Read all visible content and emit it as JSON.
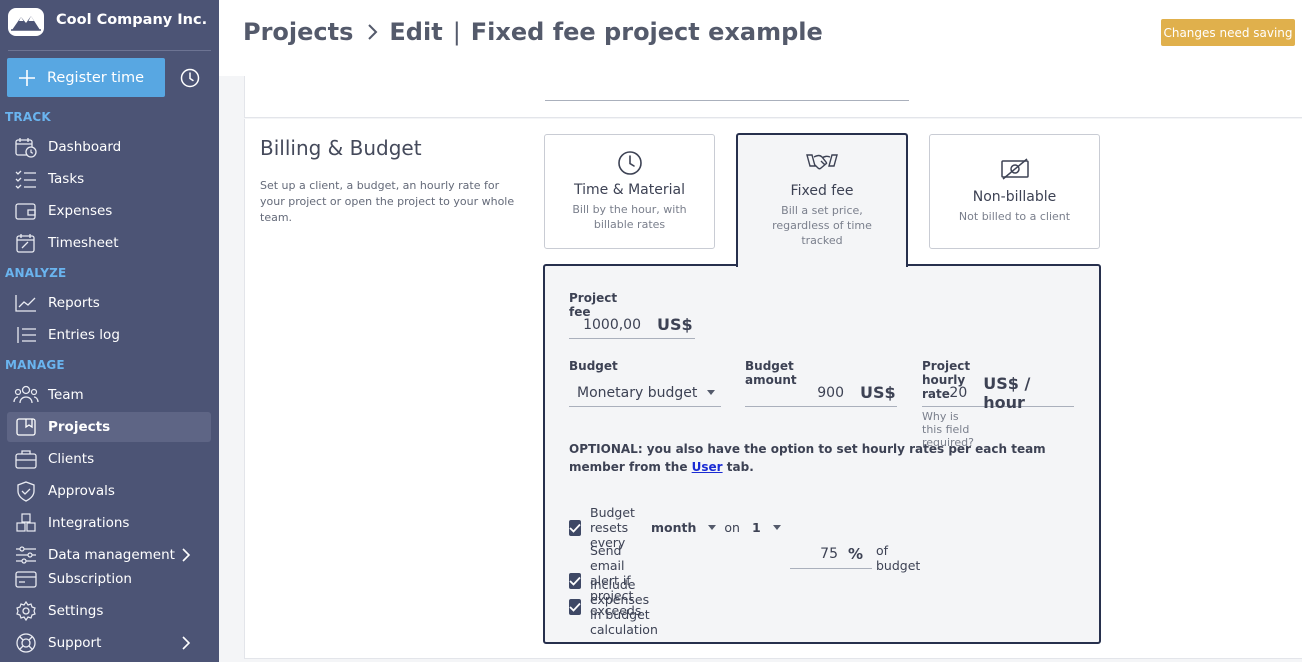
{
  "sidebar": {
    "company": "Cool Company Inc.",
    "register_label": "Register time",
    "sections": {
      "track": "TRACK",
      "analyze": "ANALYZE",
      "manage": "MANAGE"
    },
    "items": [
      {
        "label": "Dashboard",
        "icon": "calendar-clock-icon"
      },
      {
        "label": "Tasks",
        "icon": "checklist-icon"
      },
      {
        "label": "Expenses",
        "icon": "wallet-icon"
      },
      {
        "label": "Timesheet",
        "icon": "timesheet-icon"
      },
      {
        "label": "Reports",
        "icon": "chart-line-icon"
      },
      {
        "label": "Entries log",
        "icon": "list-icon"
      },
      {
        "label": "Team",
        "icon": "team-icon"
      },
      {
        "label": "Projects",
        "icon": "folder-icon",
        "active": true
      },
      {
        "label": "Clients",
        "icon": "briefcase-icon"
      },
      {
        "label": "Approvals",
        "icon": "shield-check-icon"
      },
      {
        "label": "Integrations",
        "icon": "cubes-icon"
      },
      {
        "label": "Data management",
        "icon": "sliders-icon"
      },
      {
        "label": "Subscription",
        "icon": "credit-card-icon"
      },
      {
        "label": "Settings",
        "icon": "gear-icon"
      },
      {
        "label": "Support",
        "icon": "lifebuoy-icon"
      }
    ]
  },
  "header": {
    "crumb_projects": "Projects",
    "crumb_edit": "Edit",
    "crumb_project": "Fixed fee project example",
    "save_badge": "Changes need saving"
  },
  "billing": {
    "title": "Billing & Budget",
    "description": "Set up a client, a budget, an hourly rate for your project or open the project to your whole team.",
    "options": {
      "tm": {
        "title": "Time & Material",
        "desc": "Bill by the hour, with billable rates"
      },
      "fixed": {
        "title": "Fixed fee",
        "desc": "Bill a set price, regardless of time tracked"
      },
      "nb": {
        "title": "Non-billable",
        "desc": "Not billed to a client"
      }
    }
  },
  "form": {
    "project_fee_label": "Project fee",
    "project_fee_value": "1000,00",
    "currency": "US$",
    "budget_label": "Budget",
    "budget_value": "Monetary budget",
    "budget_amount_label": "Budget amount",
    "budget_amount_value": "900",
    "hourly_rate_label": "Project hourly rate",
    "hourly_rate_value": "20",
    "hourly_rate_unit": "US$ / hour",
    "hourly_rate_hint": "Why is this field required?",
    "optional_prefix": "OPTIONAL: you also have the option to set hourly rates per each team member from the ",
    "optional_link": "User",
    "optional_suffix": " tab.",
    "reset_label": "Budget resets every",
    "reset_period": "month",
    "reset_on": "on",
    "reset_day": "1",
    "alert_label": "Send email alert if project exceeds",
    "alert_value": "75",
    "alert_unit": "%",
    "alert_suffix": "of budget",
    "expenses_label": "Include expenses in budget calculation"
  },
  "colors": {
    "sidebar": "#4c5475",
    "accent": "#58a7e2",
    "section_label": "#6ab4ef",
    "warning": "#e0b04c",
    "panel_border": "#27304d"
  }
}
